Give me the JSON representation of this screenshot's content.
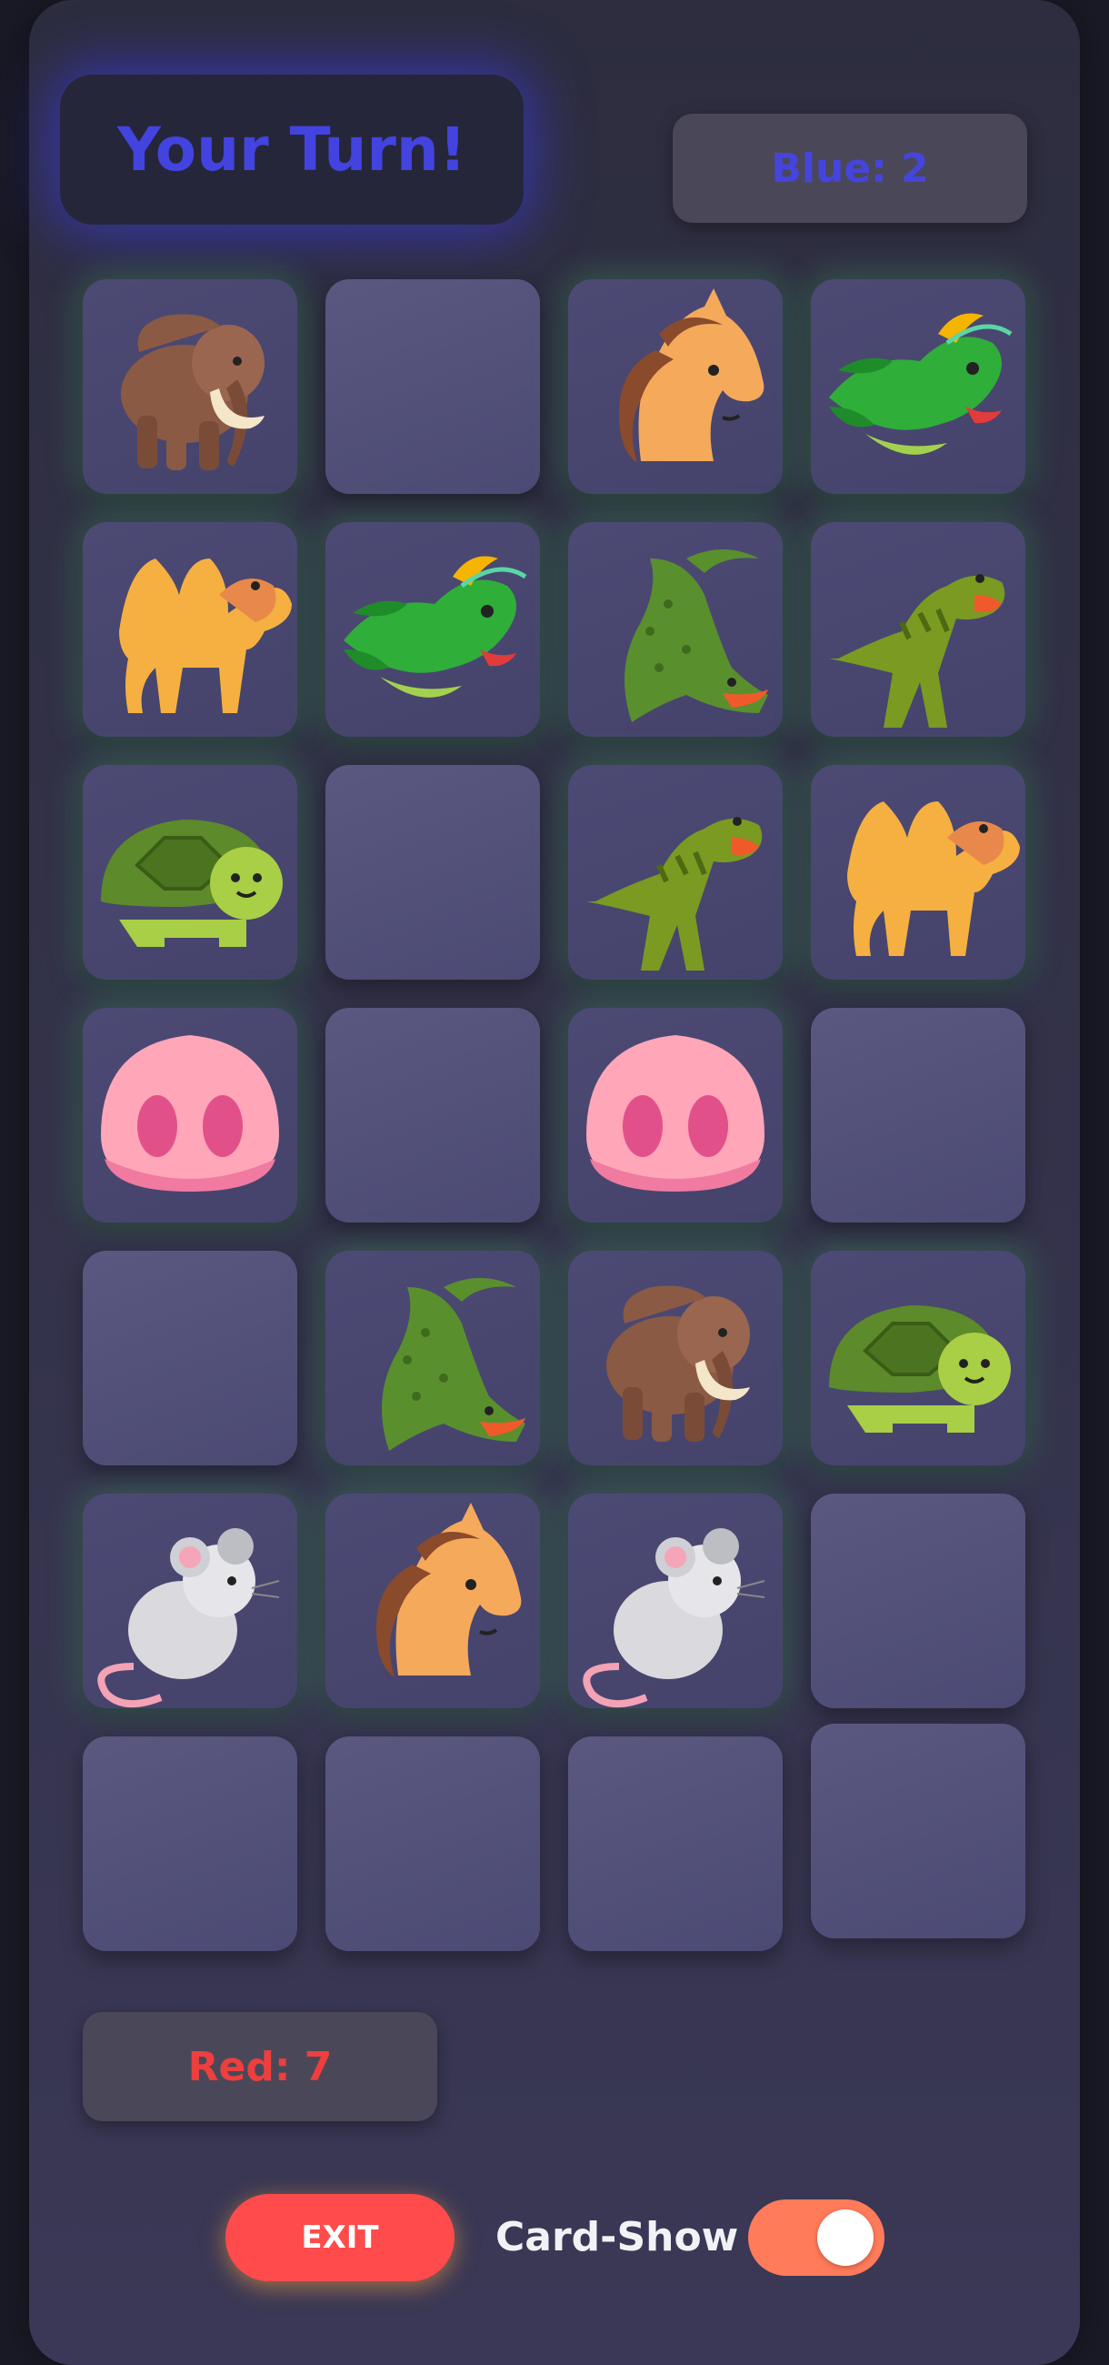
{
  "header": {
    "turn_text": "Your Turn!",
    "blue_score": "Blue: 2",
    "red_score": "Red: 7"
  },
  "colors": {
    "turn_accent": "#4343e0",
    "blue_score": "#4545dd",
    "red_score": "#ee3e3e",
    "exit_button": "#ff4b4b",
    "toggle_on": "#ff7b5a"
  },
  "board": {
    "columns": 4,
    "rows": 7,
    "cards": [
      {
        "icon": "mammoth",
        "revealed": true
      },
      {
        "icon": "",
        "revealed": false
      },
      {
        "icon": "horse",
        "revealed": true
      },
      {
        "icon": "dragon",
        "revealed": true
      },
      {
        "icon": "camel",
        "revealed": true
      },
      {
        "icon": "dragon",
        "revealed": true
      },
      {
        "icon": "crocodile",
        "revealed": true
      },
      {
        "icon": "t-rex",
        "revealed": true
      },
      {
        "icon": "turtle",
        "revealed": true
      },
      {
        "icon": "",
        "revealed": false
      },
      {
        "icon": "t-rex",
        "revealed": true
      },
      {
        "icon": "camel",
        "revealed": true
      },
      {
        "icon": "pig-nose",
        "revealed": true
      },
      {
        "icon": "",
        "revealed": false
      },
      {
        "icon": "pig-nose",
        "revealed": true
      },
      {
        "icon": "",
        "revealed": false
      },
      {
        "icon": "",
        "revealed": false
      },
      {
        "icon": "crocodile",
        "revealed": true
      },
      {
        "icon": "mammoth",
        "revealed": true
      },
      {
        "icon": "turtle",
        "revealed": true
      },
      {
        "icon": "mouse",
        "revealed": true
      },
      {
        "icon": "horse",
        "revealed": true
      },
      {
        "icon": "mouse",
        "revealed": true
      },
      {
        "icon": "",
        "revealed": false
      },
      {
        "icon": "",
        "revealed": false
      },
      {
        "icon": "",
        "revealed": false
      },
      {
        "icon": "",
        "revealed": false
      },
      {
        "icon": "",
        "revealed": false
      }
    ]
  },
  "controls": {
    "exit_label": "EXIT",
    "toggle_label": "Card-Show",
    "toggle_on": true
  }
}
